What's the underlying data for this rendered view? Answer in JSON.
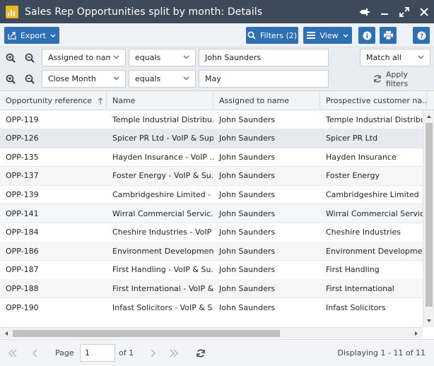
{
  "window": {
    "title": "Sales Rep Opportunities split by month: Details"
  },
  "toolbar": {
    "export_label": "Export",
    "filters_label": "Filters (2)",
    "view_label": "View"
  },
  "filters": [
    {
      "field": "Assigned to name",
      "operator": "equals",
      "value": "John Saunders"
    },
    {
      "field": "Close Month",
      "operator": "equals",
      "value": "May"
    }
  ],
  "match": {
    "value": "Match all"
  },
  "apply_label": "Apply filters",
  "grid": {
    "columns": [
      "Opportunity reference",
      "Name",
      "Assigned to name",
      "Prospective customer na..."
    ],
    "rows": [
      [
        "OPP-119",
        "Temple Industrial Distribu...",
        "John Saunders",
        "Temple Industrial Distribu..."
      ],
      [
        "OPP-126",
        "Spicer PR Ltd - VoIP & Sup...",
        "John Saunders",
        "Spicer PR Ltd"
      ],
      [
        "OPP-135",
        "Hayden Insurance - VoIP ...",
        "John Saunders",
        "Hayden Insurance"
      ],
      [
        "OPP-137",
        "Foster Energy - VoIP & Su...",
        "John Saunders",
        "Foster Energy"
      ],
      [
        "OPP-139",
        "Cambridgeshire Limited - ...",
        "John Saunders",
        "Cambridgeshire Limited"
      ],
      [
        "OPP-141",
        "Wirral Commercial Servic...",
        "John Saunders",
        "Wirral Commercial Services"
      ],
      [
        "OPP-184",
        "Cheshire Industries - VoIP ...",
        "John Saunders",
        "Cheshire Industries"
      ],
      [
        "OPP-186",
        "Environment Developmen...",
        "John Saunders",
        "Environment Developmen..."
      ],
      [
        "OPP-187",
        "First Handling - VoIP & Su...",
        "John Saunders",
        "First Handling"
      ],
      [
        "OPP-188",
        "First International - VoIP &...",
        "John Saunders",
        "First International"
      ],
      [
        "OPP-190",
        "Infast Solicitors - VoIP & S...",
        "John Saunders",
        "Infast Solicitors"
      ]
    ]
  },
  "pager": {
    "page_label": "Page",
    "page_value": "1",
    "of_label": "of 1",
    "display_text": "Displaying 1 - 11 of 11"
  },
  "colors": {
    "titlebar": "#3d4a5a",
    "accent": "#2f6fb3",
    "app_icon": "#f0b429"
  },
  "icons": {
    "app": "bar-chart-icon",
    "pin": "pin-icon",
    "minimize": "minimize-icon",
    "maximize": "maximize-icon",
    "close": "close-icon",
    "info": "info-icon",
    "print": "print-icon",
    "help": "help-icon",
    "refresh": "refresh-icon"
  }
}
